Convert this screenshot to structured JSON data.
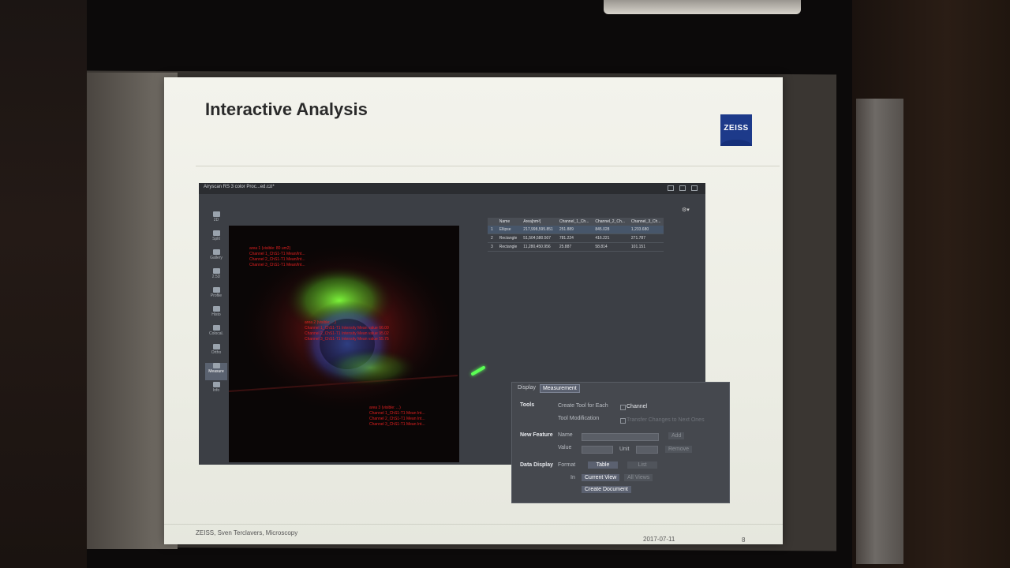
{
  "slide": {
    "title": "Interactive Analysis",
    "logo_text": "ZEISS",
    "footer_left": "ZEISS, Sven Terclavers, Microscopy",
    "footer_date": "2017-07-11",
    "footer_page": "8"
  },
  "app": {
    "tab_title": "Airyscan RS 3 color Proc...ed.czi*",
    "left_toolbar": [
      "2D",
      "Split",
      "Gallery",
      "2.5D",
      "Profile",
      "Histo",
      "Colocal.",
      "Ortho",
      "Measure",
      "Info"
    ],
    "active_tool": "Measure",
    "annotations_top": "area 1 (visible: 80 um2)\nChannel 1_ChS1-T1 Mean/Int...\nChannel 2_ChS1-T1 Mean/Int...\nChannel 3_ChS1-T1 Mean/Int...",
    "annotations_mid": "area 2 (visible: ...)\nChannel 1_ChS1-T1 Intensity Mean value 66.00\nChannel 2_ChS1-T1 Intensity Mean value 95.02\nChannel 3_ChS1-T1 Intensity Mean value 55.75",
    "annotations_bottom": "area 3 (visible: ...)\nChannel 1_ChS1-T1 Mean Int...\nChannel 2_ChS1-T1 Mean Int...\nChannel 3_ChS1-T1 Mean Int..."
  },
  "table": {
    "headers": [
      "",
      "Name",
      "Area[nm²]",
      "Channel_1_Ch...",
      "Channel_2_Ch...",
      "Channel_3_Ch..."
    ],
    "rows": [
      [
        "1",
        "Ellipse",
        "217,998,595.851",
        "251.889",
        "845.028",
        "1,233.680"
      ],
      [
        "2",
        "Rectangle",
        "51,504,580.507",
        "781.224",
        "416.221",
        "271.787"
      ],
      [
        "3",
        "Rectangle",
        "11,280,450.956",
        "25.887",
        "58.814",
        "101.151"
      ]
    ]
  },
  "panel": {
    "tab_display": "Display",
    "tab_measurement": "Measurement",
    "tools_label": "Tools",
    "create_tool_label": "Create Tool for Each",
    "channel_label": "Channel",
    "tool_mod_label": "Tool Modification",
    "transfer_label": "Transfer Changes to Next Ones",
    "new_feature_label": "New Feature",
    "name_label": "Name",
    "add_label": "Add",
    "value_label": "Value",
    "unit_label": "Unit",
    "remove_label": "Remove",
    "data_display_label": "Data Display",
    "format_label": "Format",
    "table_btn": "Table",
    "list_btn": "List",
    "in_label": "In",
    "current_view_btn": "Current View",
    "all_views_btn": "All Views",
    "create_document_btn": "Create Document"
  }
}
